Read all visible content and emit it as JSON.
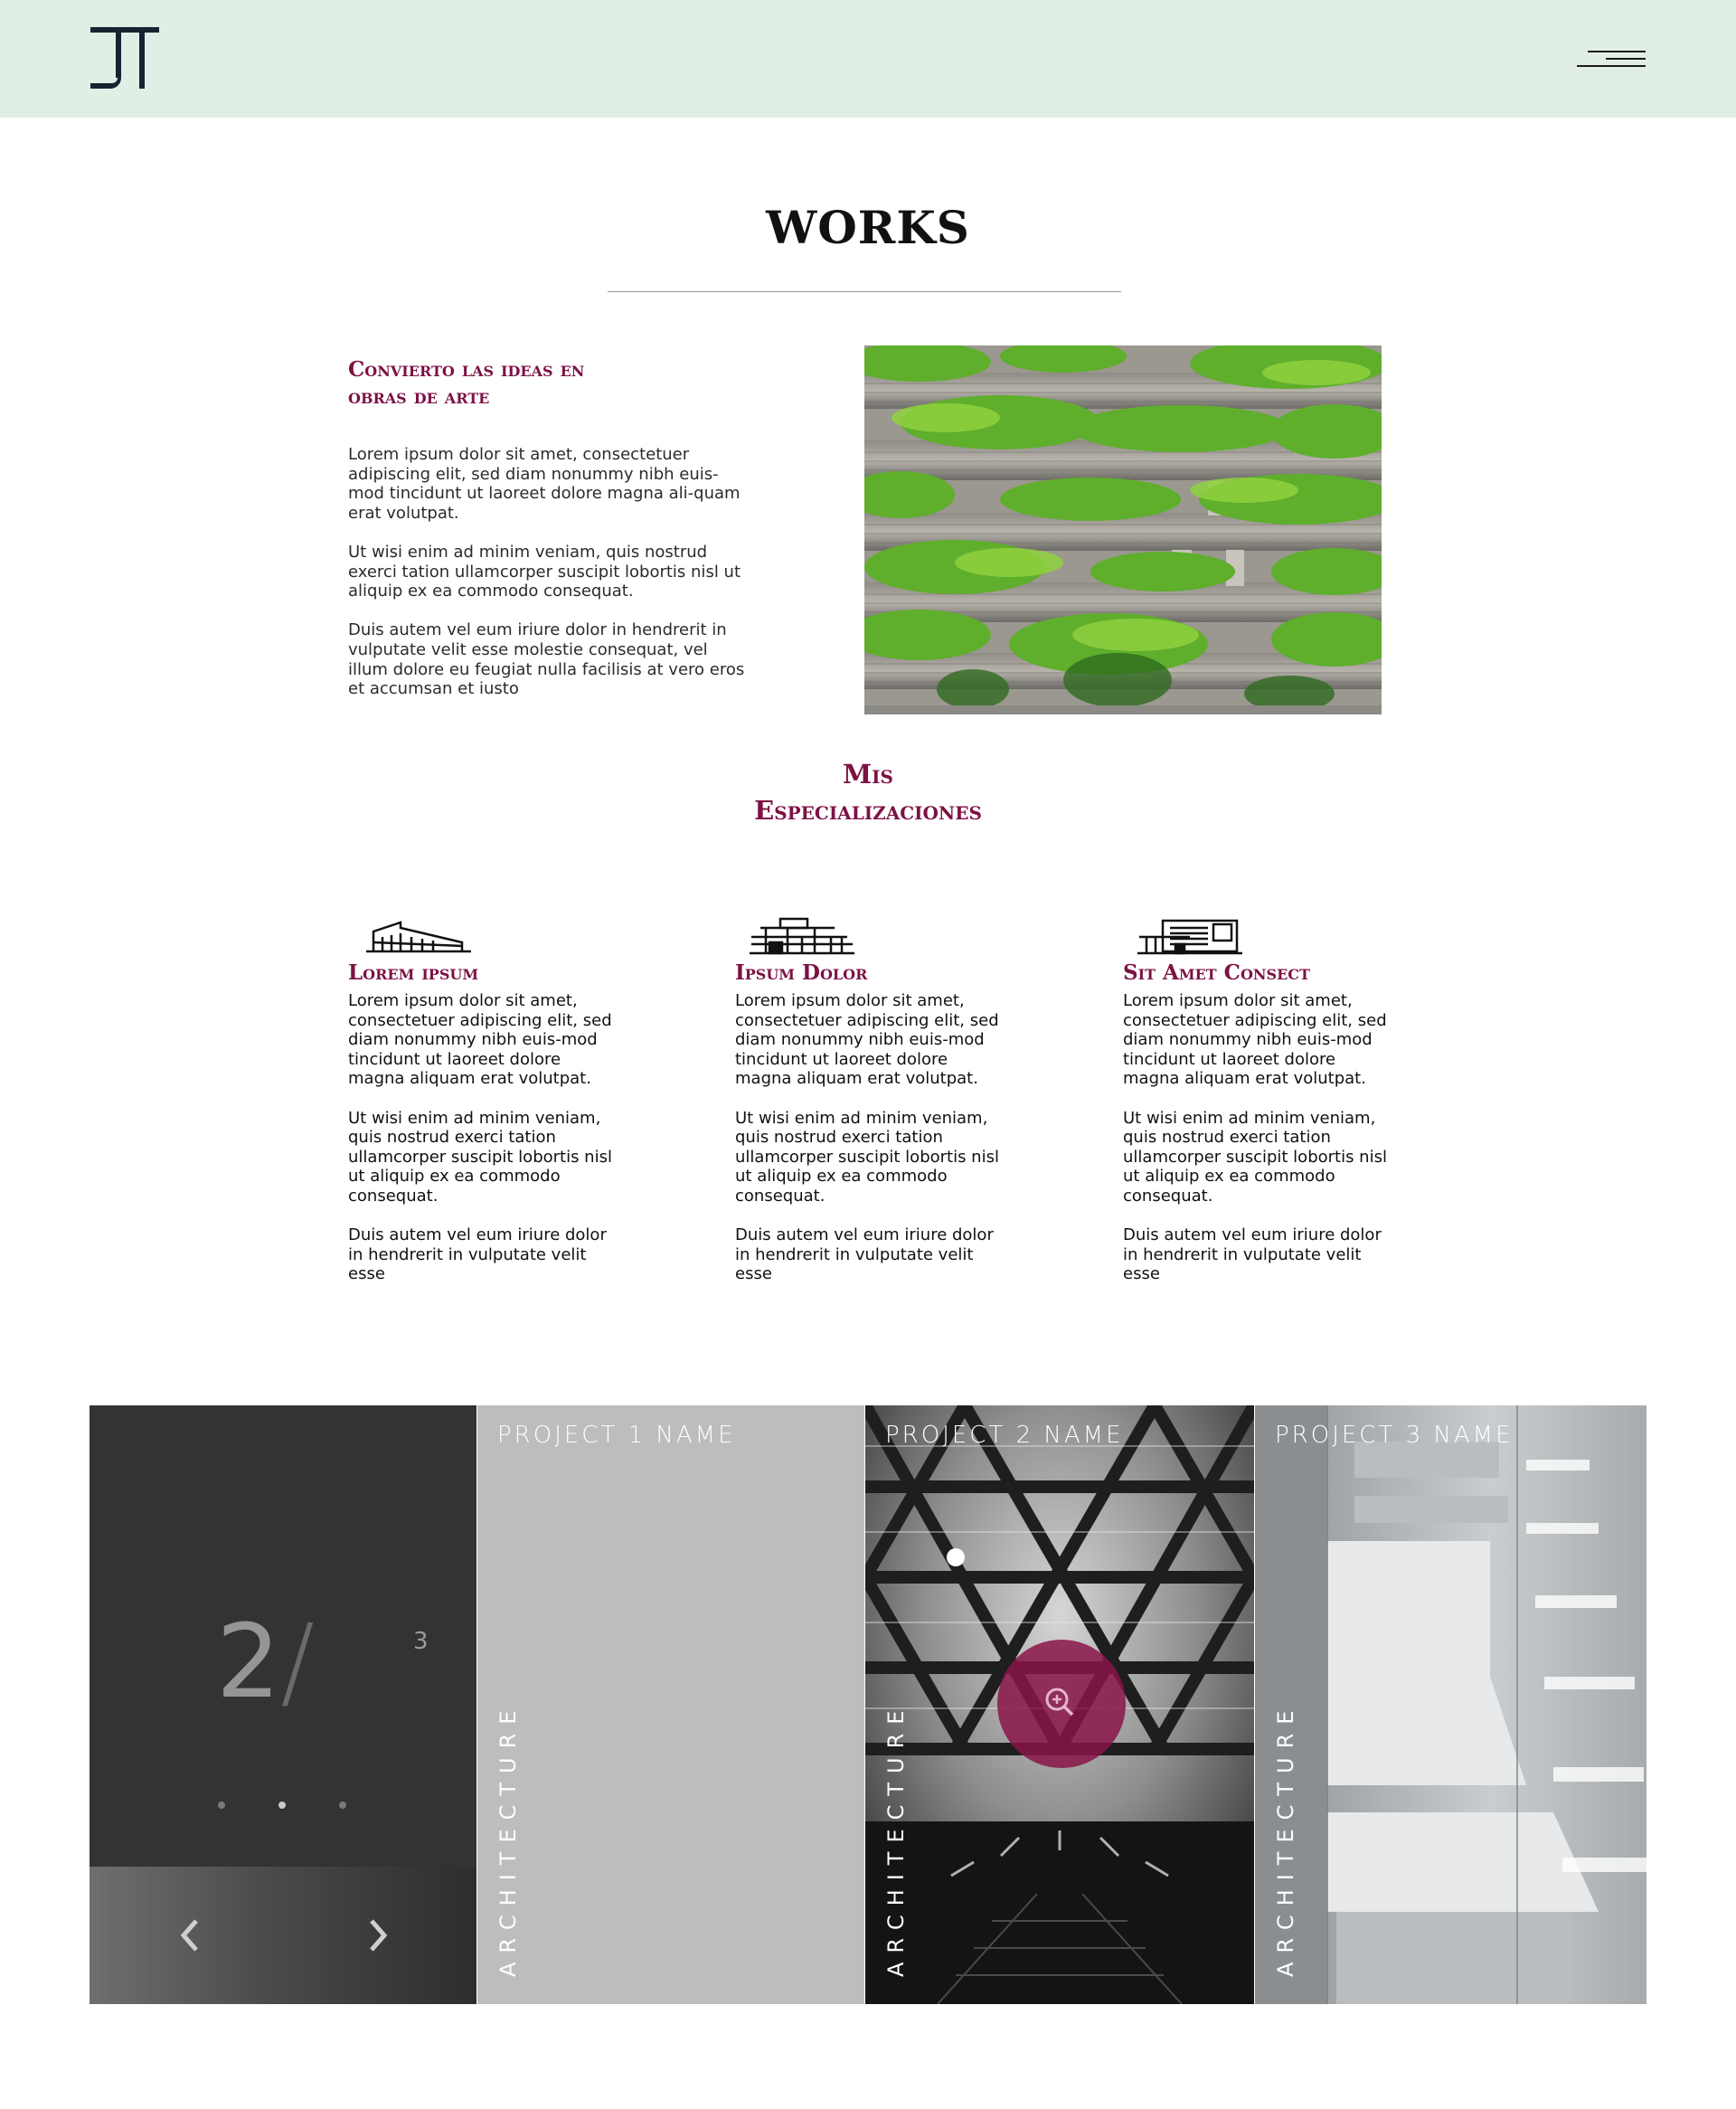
{
  "header": {
    "logo_text": "JT",
    "menu_icon": "hamburger-icon"
  },
  "works": {
    "title": "WORKS"
  },
  "intro": {
    "heading": "Convierto las ideas en obras de arte",
    "paragraphs": [
      "Lorem ipsum dolor sit amet, consectetuer adipiscing elit, sed diam nonummy nibh euis-mod tincidunt ut laoreet dolore magna ali-quam erat volutpat.",
      "Ut wisi enim ad minim veniam, quis nostrud exerci tation ullamcorper suscipit lobortis nisl ut aliquip ex ea commodo consequat.",
      "Duis autem vel eum iriure dolor in hendrerit in vulputate velit esse molestie consequat, vel illum dolore eu feugiat nulla facilisis at vero eros et accumsan et iusto"
    ]
  },
  "specializations": {
    "title_line1": "Mis",
    "title_line2": "Especializaciones",
    "items": [
      {
        "name": "Lorem ipsum",
        "icon": "building-icon",
        "paragraphs": [
          "Lorem ipsum dolor sit amet, consectetuer adipiscing elit, sed diam nonummy nibh euis-mod tincidunt ut laoreet dolore magna aliquam erat volutpat.",
          "Ut wisi enim ad minim veniam, quis nostrud exerci tation ullamcorper suscipit lobortis nisl ut aliquip ex ea commodo consequat.",
          "Duis autem vel eum iriure dolor in hendrerit in vulputate velit esse"
        ]
      },
      {
        "name": "Ipsum Dolor",
        "icon": "house-icon",
        "paragraphs": [
          "Lorem ipsum dolor sit amet, consectetuer adipiscing elit, sed diam nonummy nibh euis-mod tincidunt ut laoreet dolore magna aliquam erat volutpat.",
          "Ut wisi enim ad minim veniam, quis nostrud exerci tation ullamcorper suscipit lobortis nisl ut aliquip ex ea commodo consequat.",
          "Duis autem vel eum iriure dolor in hendrerit in vulputate velit esse"
        ]
      },
      {
        "name": "Sit Amet Consect",
        "icon": "modern-house-icon",
        "paragraphs": [
          "Lorem ipsum dolor sit amet, consectetuer adipiscing elit, sed diam nonummy nibh euis-mod tincidunt ut laoreet dolore magna aliquam erat volutpat.",
          "Ut wisi enim ad minim veniam, quis nostrud exerci tation ullamcorper suscipit lobortis nisl ut aliquip ex ea commodo consequat.",
          "Duis autem vel eum iriure dolor in hendrerit in vulputate velit esse"
        ]
      }
    ]
  },
  "gallery": {
    "current": "2",
    "slash": "/",
    "total": "3",
    "active_dot": 1,
    "projects": [
      {
        "title": "PROJECT 1 NAME",
        "tag": "ARCHITECTURE"
      },
      {
        "title": "PROJECT 2 NAME",
        "tag": "ARCHITECTURE"
      },
      {
        "title": "PROJECT 3 NAME",
        "tag": "ARCHITECTURE"
      }
    ],
    "colors": {
      "accent": "#7d1144",
      "panel": "#333333",
      "card1": "#bdbdbd"
    }
  }
}
